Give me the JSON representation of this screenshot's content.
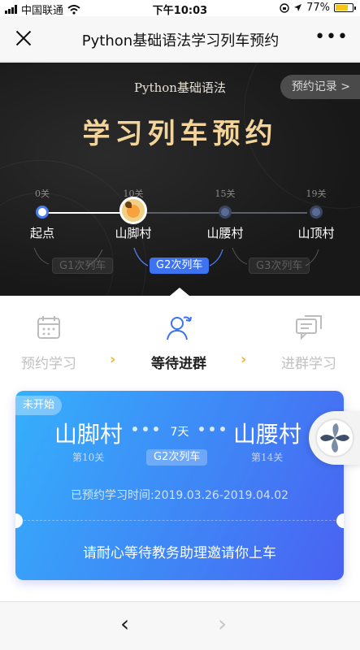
{
  "status_bar": {
    "carrier": "中国联通",
    "time": "下午10:03",
    "battery": "77%",
    "battery_level": 0.77
  },
  "navbar": {
    "title": "Python基础语法学习列车预约"
  },
  "hero": {
    "subtitle": "Python基础语法",
    "title": "学习列车预约",
    "records_link": "预约记录 >",
    "stations": [
      {
        "level": "0关",
        "name": "起点",
        "state": "done"
      },
      {
        "level": "10关",
        "name": "山脚村",
        "state": "current"
      },
      {
        "level": "15关",
        "name": "山腰村",
        "state": "todo"
      },
      {
        "level": "19关",
        "name": "山顶村",
        "state": "todo"
      }
    ],
    "trains": [
      {
        "label": "G1次列车",
        "active": false
      },
      {
        "label": "G2次列车",
        "active": true
      },
      {
        "label": "G3次列车",
        "active": false
      }
    ]
  },
  "steps": [
    {
      "label": "预约学习",
      "icon": "calendar-icon",
      "active": false
    },
    {
      "label": "等待进群",
      "icon": "person-refresh-icon",
      "active": true
    },
    {
      "label": "进群学习",
      "icon": "chat-icon",
      "active": false
    }
  ],
  "ticket": {
    "status": "未开始",
    "from": "山脚村",
    "to": "山腰村",
    "duration": "7天",
    "from_level": "第10关",
    "to_level": "第14关",
    "train": "G2次列车",
    "time_text": "已预约学习时间:2019.03.26-2019.04.02",
    "wait_text": "请耐心等待教务助理邀请你上车"
  },
  "colors": {
    "accent": "#3d73f0",
    "gold": "#f3d49b",
    "step_arrow": "#f3b83a"
  }
}
